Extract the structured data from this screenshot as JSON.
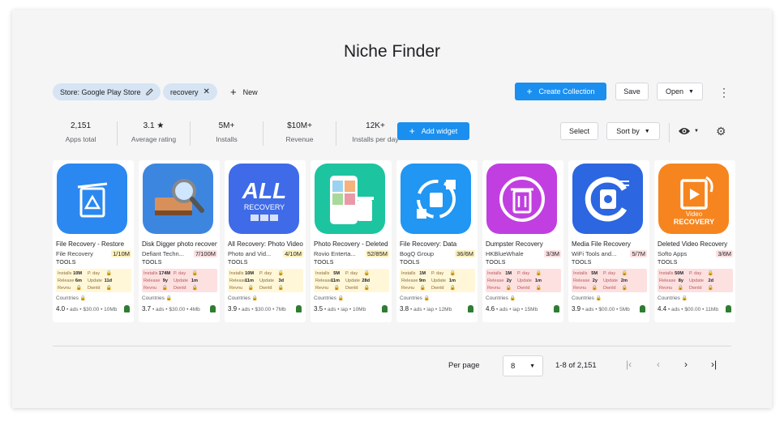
{
  "title": "Niche Finder",
  "filters": {
    "store_chip": "Store: Google Play Store",
    "keyword_chip": "recovery",
    "new_label": "New"
  },
  "toolbar": {
    "create_collection": "Create Collection",
    "save": "Save",
    "open": "Open"
  },
  "stats": [
    {
      "value": "2,151",
      "label": "Apps total"
    },
    {
      "value": "3.1 ★",
      "label": "Average rating"
    },
    {
      "value": "5M+",
      "label": "Installs"
    },
    {
      "value": "$10M+",
      "label": "Revenue"
    },
    {
      "value": "12K+",
      "label": "Installs per day"
    }
  ],
  "actions": {
    "add_widget": "Add widget",
    "select": "Select",
    "sort_by": "Sort by"
  },
  "metric_labels": {
    "installs": "Installs",
    "pday": "P. day",
    "release": "Release",
    "update": "Update",
    "revnu": "Revnu",
    "dwnld": "Dwnld",
    "countries": "Countries"
  },
  "apps": [
    {
      "name": "File Recovery - Restore",
      "developer": "File Recovery",
      "ratio": "1/10M",
      "ratio_color": "#fff3c2",
      "category": "TOOLS",
      "installs": "10M",
      "release": "6m",
      "update": "11d",
      "grid_style": "yellow",
      "rating": "4.0",
      "meta": "• ads • $30.00 • 10Mb",
      "icon_bg": "#2b88f0",
      "icon": "trash-recycle-icon"
    },
    {
      "name": "Disk Digger photo recovery",
      "developer": "Defiant Techn...",
      "ratio": "7/100M",
      "ratio_color": "#fde2e2",
      "category": "TOOLS",
      "installs": "174M",
      "release": "9y",
      "update": "1m",
      "grid_style": "pink",
      "rating": "3.7",
      "meta": "• ads • $30.00 • 4Mb",
      "icon_bg": "#3d86e0",
      "icon": "disk-search-icon"
    },
    {
      "name": "All Recovery: Photo Video",
      "developer": "Photo and Vid...",
      "ratio": "4/10M",
      "ratio_color": "#fff3c2",
      "category": "TOOLS",
      "installs": "10M",
      "release": "11m",
      "update": "3d",
      "grid_style": "yellow",
      "rating": "3.9",
      "meta": "• ads • $30.00 • 7Mb",
      "icon_bg": "#3f6be8",
      "icon": "all-recovery-icon"
    },
    {
      "name": "Photo Recovery - Deleted",
      "developer": "Rovio Enterta...",
      "ratio": "52/85M",
      "ratio_color": "#fff3c2",
      "category": "TOOLS",
      "installs": "5M",
      "release": "11m",
      "update": "28d",
      "grid_style": "yellow",
      "rating": "3.5",
      "meta": "• ads • iap • 10Mb",
      "icon_bg": "#1dc4a0",
      "icon": "phone-photos-icon"
    },
    {
      "name": "File Recovery: Data",
      "developer": "BogQ Group",
      "ratio": "36/6M",
      "ratio_color": "#fff3c2",
      "category": "TOOLS",
      "installs": "1M",
      "release": "9m",
      "update": "1m",
      "grid_style": "yellow",
      "rating": "3.8",
      "meta": "• ads • iap • 12Mb",
      "icon_bg": "#2196f3",
      "icon": "recycle-files-icon"
    },
    {
      "name": "Dumpster Recovery",
      "developer": "HKBlueWhale",
      "ratio": "3/3M",
      "ratio_color": "#fde2e2",
      "category": "TOOLS",
      "installs": "1M",
      "release": "2y",
      "update": "1m",
      "grid_style": "pink",
      "rating": "4.6",
      "meta": "• ads • iap • 15Mb",
      "icon_bg": "#c13fe0",
      "icon": "dumpster-icon"
    },
    {
      "name": "Media File Recovery",
      "developer": "WiFi Tools and...",
      "ratio": "5/7M",
      "ratio_color": "#fde2e2",
      "category": "TOOLS",
      "installs": "5M",
      "release": "2y",
      "update": "2m",
      "grid_style": "pink",
      "rating": "3.9",
      "meta": "• ads • $00.00 • 5Mb",
      "icon_bg": "#2c66e0",
      "icon": "media-recovery-icon"
    },
    {
      "name": "Deleted Video Recovery",
      "developer": "Softo Apps",
      "ratio": "3/6M",
      "ratio_color": "#fde2e2",
      "category": "TOOLS",
      "installs": "50M",
      "release": "8y",
      "update": "2d",
      "grid_style": "pink",
      "rating": "4.4",
      "meta": "• ads • $00.00 • 11Mb",
      "icon_bg": "#f6851f",
      "icon": "video-recovery-icon",
      "icon_text": "Video RECOVERY"
    }
  ],
  "pagination": {
    "per_page_label": "Per page",
    "per_page": "8",
    "range": "1-8 of 2,151"
  },
  "colors": {
    "accent": "#1a8ff0",
    "chip": "#d6e4f3"
  }
}
